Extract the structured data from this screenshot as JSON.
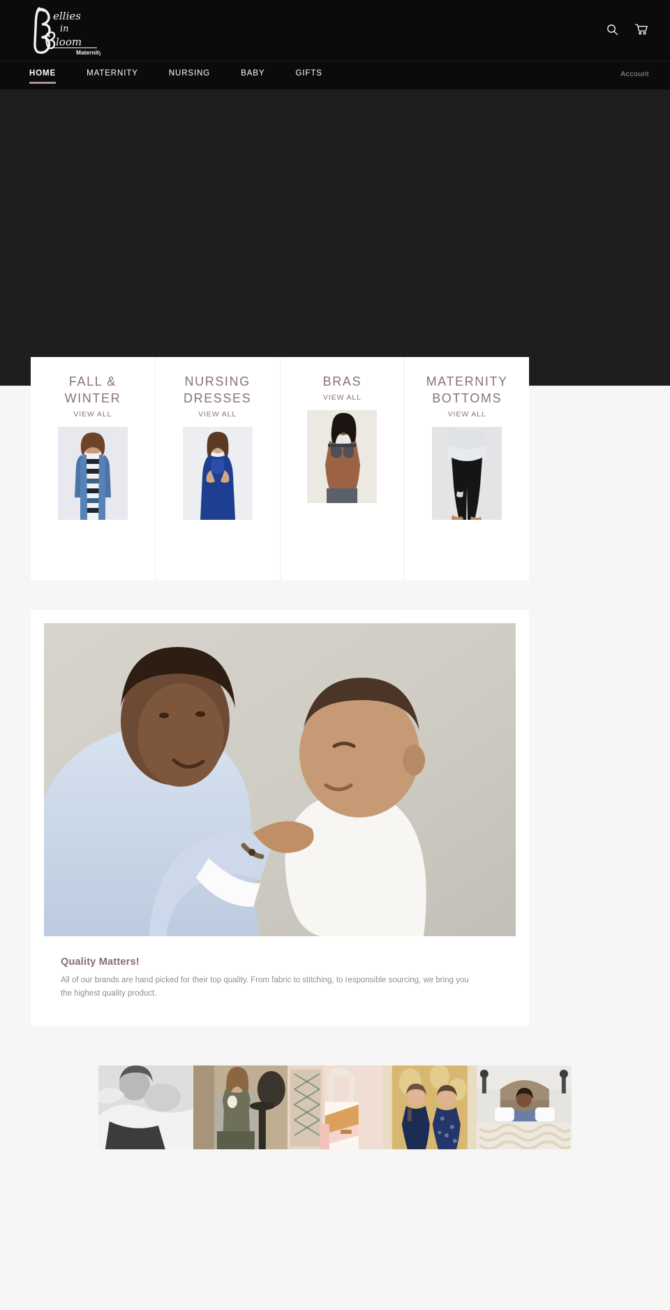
{
  "site": {
    "brand_name": "Bellies in Bloom",
    "brand_script_line1": "ellies",
    "brand_script_line2": "in",
    "brand_script_line3": "loom",
    "brand_initial_b1": "B",
    "brand_initial_b2": "B",
    "brand_subtitle": "Maternity"
  },
  "header": {
    "search_icon": "search-icon",
    "cart_icon": "cart-icon"
  },
  "nav": {
    "items": [
      {
        "label": "HOME",
        "active": true
      },
      {
        "label": "MATERNITY",
        "active": false
      },
      {
        "label": "NURSING",
        "active": false
      },
      {
        "label": "BABY",
        "active": false
      },
      {
        "label": "GIFTS",
        "active": false
      }
    ],
    "account_label": "Account"
  },
  "collections": {
    "view_all_label": "VIEW ALL",
    "items": [
      {
        "title": "FALL & WINTER",
        "image_alt": "woman in denim jacket and striped dress"
      },
      {
        "title": "NURSING DRESSES",
        "image_alt": "woman in blue nursing dress"
      },
      {
        "title": "BRAS",
        "image_alt": "woman wearing grey nursing bra"
      },
      {
        "title": "MATERNITY BOTTOMS",
        "image_alt": "woman in black maternity leggings"
      }
    ]
  },
  "feature": {
    "image_alt": "mother holding smiling baby",
    "title": "Quality Matters!",
    "body": "All of our brands are hand picked for their top quality. From fabric to stitching, to responsible sourcing, we bring you the highest quality product."
  },
  "gallery": {
    "tiles": [
      {
        "alt": "black and white photo of mother nursing baby on bed"
      },
      {
        "alt": "woman in grey cardigan seated in chair holding cup"
      },
      {
        "alt": "pink and tan colorblock diaper bag"
      },
      {
        "alt": "two women laughing in front of gold backdrop"
      },
      {
        "alt": "woman in bed with chunky knit blanket"
      }
    ]
  },
  "colors": {
    "nav_background": "#0b0b0b",
    "hero_background": "#1e1e1e",
    "page_background": "#f6f6f6",
    "accent_mauve": "#8a7178",
    "active_underline": "#a89399",
    "feature_title": "#8a6b74",
    "body_text": "#8e8e8e",
    "card_background": "#ffffff"
  }
}
